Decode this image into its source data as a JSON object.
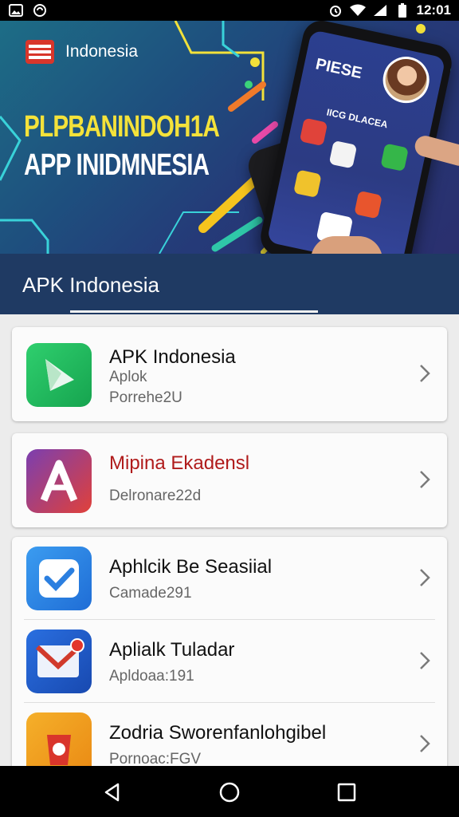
{
  "status_bar": {
    "time": "12:01",
    "left_icons": [
      "image-notification-icon",
      "sync-notification-icon"
    ],
    "right_icons": [
      "alarm-icon",
      "wifi-icon",
      "signal-icon",
      "battery-icon"
    ]
  },
  "hero": {
    "brand": "Indonesia",
    "title_line1": "PLPBANINDOH1A",
    "title_line2": "APP INIDMNESIA",
    "phone_text1": "PIESE",
    "phone_text2": "IICG DLACEA",
    "colors": {
      "title_yellow": "#f4e23a",
      "bg_teal": "#1d6d86",
      "bg_navy": "#2a2f6e"
    }
  },
  "app_bar": {
    "title": "APK Indonesia",
    "color": "#1f3a63"
  },
  "apps": [
    {
      "name": "APK Indonesia",
      "line1": "Aplok",
      "line2": "Porrehe2U",
      "icon": "play-triangle-icon",
      "icon_color": "#22b35e",
      "name_color": "#111111"
    },
    {
      "name": "Mipina Ekadensl",
      "line1": "Delronare22d",
      "icon": "letter-a-icon",
      "icon_color": "#7b3fb0",
      "name_color": "#b01b1b"
    },
    {
      "name": "Aphlcik Be Seasiial",
      "line1": "Camade291",
      "icon": "checkmark-icon",
      "icon_color": "#2b7fe0",
      "name_color": "#111111"
    },
    {
      "name": "Aplialk Tuladar",
      "line1": "Apldoaa:191",
      "icon": "mail-play-icon",
      "icon_color": "#1f57c7",
      "name_color": "#111111"
    },
    {
      "name": "Zodria Sworenfanlohgibel",
      "line1": "Pornoac:FGV",
      "icon": "shopping-bag-icon",
      "icon_color": "#f0a21e",
      "name_color": "#111111"
    }
  ],
  "nav_bar": {
    "buttons": [
      "back-icon",
      "home-icon",
      "recents-icon"
    ]
  }
}
